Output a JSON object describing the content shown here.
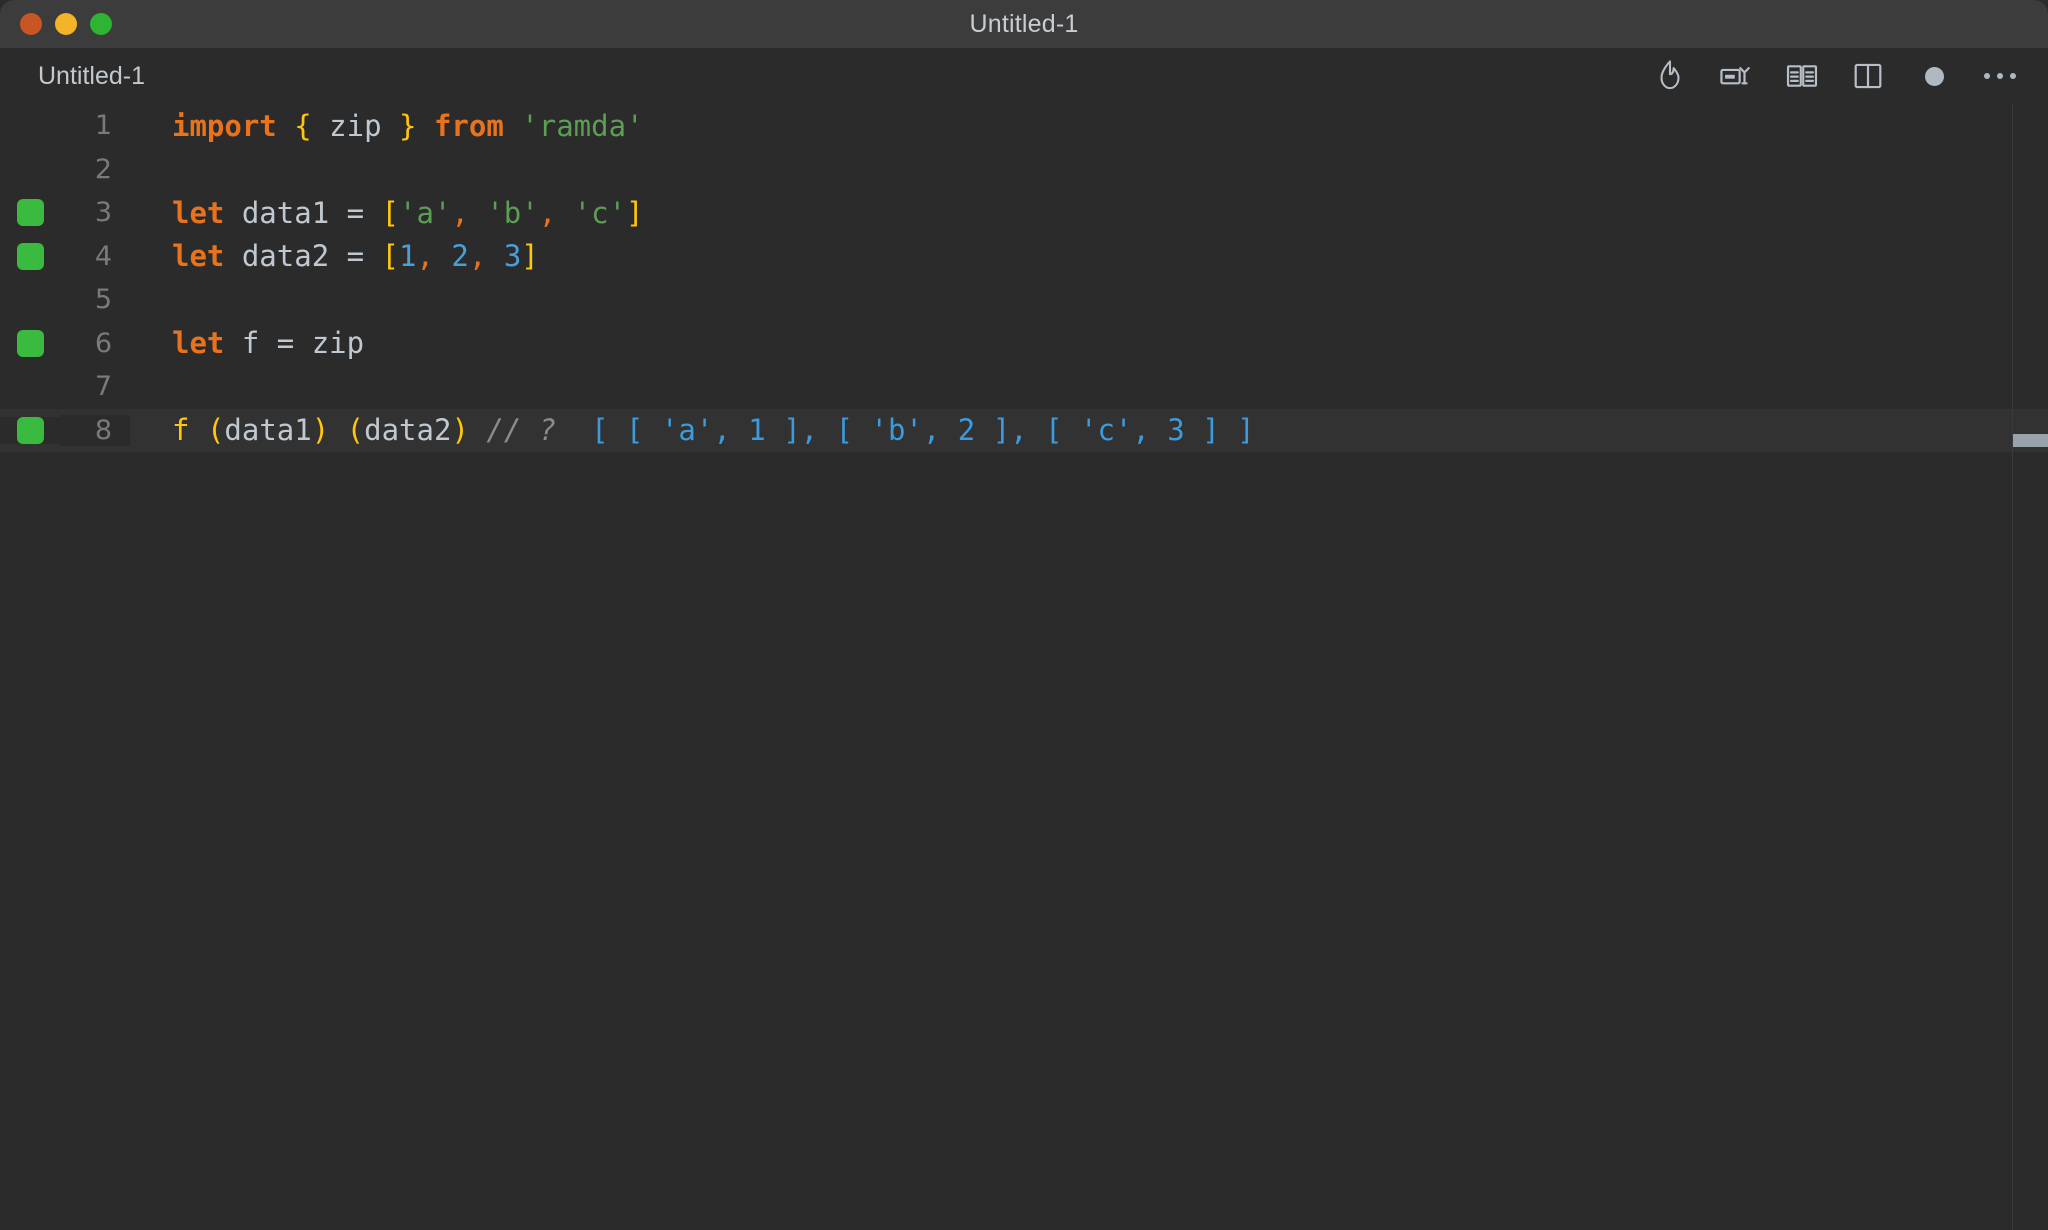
{
  "window": {
    "title": "Untitled-1",
    "traffic_lights": [
      {
        "name": "close",
        "color": "#c85524"
      },
      {
        "name": "minimize",
        "color": "#f5b428"
      },
      {
        "name": "zoom",
        "color": "#2eb333"
      }
    ]
  },
  "tabstrip": {
    "tab_label": "Untitled-1",
    "toolbar_icons": [
      {
        "name": "flame-icon",
        "label": "Run / Quokka"
      },
      {
        "name": "run-console-icon",
        "label": "Show Output"
      },
      {
        "name": "book-open-icon",
        "label": "Open Docs"
      },
      {
        "name": "split-editor-icon",
        "label": "Split Editor"
      },
      {
        "name": "status-dot-icon",
        "label": "Status"
      },
      {
        "name": "ellipsis-icon",
        "label": "More Actions"
      }
    ]
  },
  "editor": {
    "accent_colors": {
      "keyword": "#e8731c",
      "plain": "#c0c9d2",
      "brace": "#ffc60a",
      "string": "#5b9e54",
      "number": "#4a9fd8",
      "comment": "#8b8b8b",
      "inline_result": "#3b9bdd",
      "breakpoint": "#3aba3f",
      "line_number": "#7a7a7a",
      "background": "#2b2b2b",
      "current_line": "#323232"
    },
    "lines": [
      {
        "number": "1",
        "breakpoint": false,
        "current": false,
        "tokens": [
          {
            "t": "import",
            "c": "kw"
          },
          {
            "t": " ",
            "c": "plain"
          },
          {
            "t": "{",
            "c": "brace"
          },
          {
            "t": " ",
            "c": "plain"
          },
          {
            "t": "zip",
            "c": "plain"
          },
          {
            "t": " ",
            "c": "plain"
          },
          {
            "t": "}",
            "c": "brace"
          },
          {
            "t": " ",
            "c": "plain"
          },
          {
            "t": "from",
            "c": "kw"
          },
          {
            "t": " ",
            "c": "plain"
          },
          {
            "t": "'ramda'",
            "c": "str"
          }
        ]
      },
      {
        "number": "2",
        "breakpoint": false,
        "current": false,
        "tokens": []
      },
      {
        "number": "3",
        "breakpoint": true,
        "current": false,
        "tokens": [
          {
            "t": "let",
            "c": "kw"
          },
          {
            "t": " data1 = ",
            "c": "plain"
          },
          {
            "t": "[",
            "c": "brace"
          },
          {
            "t": "'a'",
            "c": "str"
          },
          {
            "t": ",",
            "c": "punct"
          },
          {
            "t": " ",
            "c": "plain"
          },
          {
            "t": "'b'",
            "c": "str"
          },
          {
            "t": ",",
            "c": "punct"
          },
          {
            "t": " ",
            "c": "plain"
          },
          {
            "t": "'c'",
            "c": "str"
          },
          {
            "t": "]",
            "c": "brace"
          }
        ]
      },
      {
        "number": "4",
        "breakpoint": true,
        "current": false,
        "tokens": [
          {
            "t": "let",
            "c": "kw"
          },
          {
            "t": " data2 = ",
            "c": "plain"
          },
          {
            "t": "[",
            "c": "brace"
          },
          {
            "t": "1",
            "c": "num"
          },
          {
            "t": ",",
            "c": "punct"
          },
          {
            "t": " ",
            "c": "plain"
          },
          {
            "t": "2",
            "c": "num"
          },
          {
            "t": ",",
            "c": "punct"
          },
          {
            "t": " ",
            "c": "plain"
          },
          {
            "t": "3",
            "c": "num"
          },
          {
            "t": "]",
            "c": "brace"
          }
        ]
      },
      {
        "number": "5",
        "breakpoint": false,
        "current": false,
        "tokens": []
      },
      {
        "number": "6",
        "breakpoint": true,
        "current": false,
        "tokens": [
          {
            "t": "let",
            "c": "kw"
          },
          {
            "t": " f = zip",
            "c": "plain"
          }
        ]
      },
      {
        "number": "7",
        "breakpoint": false,
        "current": false,
        "tokens": []
      },
      {
        "number": "8",
        "breakpoint": true,
        "current": true,
        "tokens": [
          {
            "t": "f",
            "c": "fn"
          },
          {
            "t": " ",
            "c": "plain"
          },
          {
            "t": "(",
            "c": "brace"
          },
          {
            "t": "data1",
            "c": "plain"
          },
          {
            "t": ")",
            "c": "brace"
          },
          {
            "t": " ",
            "c": "plain"
          },
          {
            "t": "(",
            "c": "brace"
          },
          {
            "t": "data2",
            "c": "plain"
          },
          {
            "t": ")",
            "c": "brace"
          },
          {
            "t": " ",
            "c": "plain"
          },
          {
            "t": "// ?",
            "c": "comment"
          },
          {
            "t": "  [ [ 'a', 1 ], [ 'b', 2 ], [ 'c', 3 ] ]",
            "c": "result"
          }
        ]
      }
    ]
  }
}
